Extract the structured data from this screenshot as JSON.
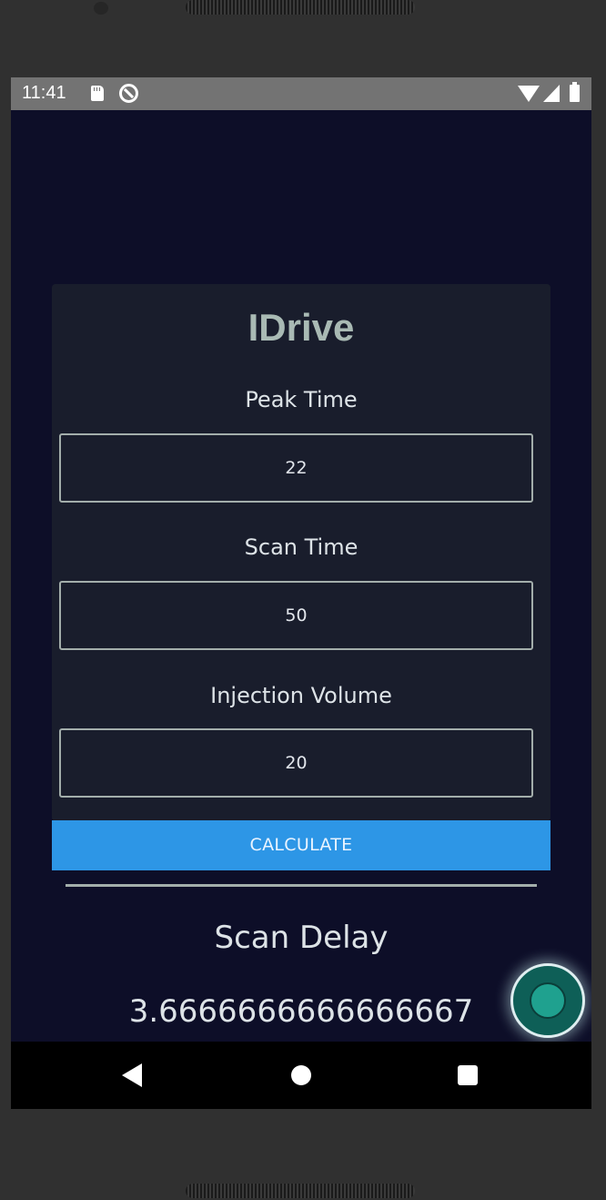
{
  "status_bar": {
    "time": "11:41",
    "icons": [
      "sd-card-icon",
      "do-not-disturb-icon",
      "wifi-icon",
      "cell-signal-icon",
      "battery-icon"
    ]
  },
  "app": {
    "title": "IDrive",
    "fields": [
      {
        "label": "Peak Time",
        "value": "22"
      },
      {
        "label": "Scan Time",
        "value": "50"
      },
      {
        "label": "Injection Volume",
        "value": "20"
      }
    ],
    "calculate_label": "CALCULATE",
    "result_label": "Scan Delay",
    "result_value": "3.6666666666666667"
  },
  "nav_bar": {
    "icons": [
      "back-icon",
      "home-icon",
      "recents-icon"
    ]
  },
  "colors": {
    "background": "#0d0e28",
    "card": "#191d2c",
    "title": "#a9bab4",
    "button": "#2d96e6",
    "fab": "#0e5f57"
  }
}
